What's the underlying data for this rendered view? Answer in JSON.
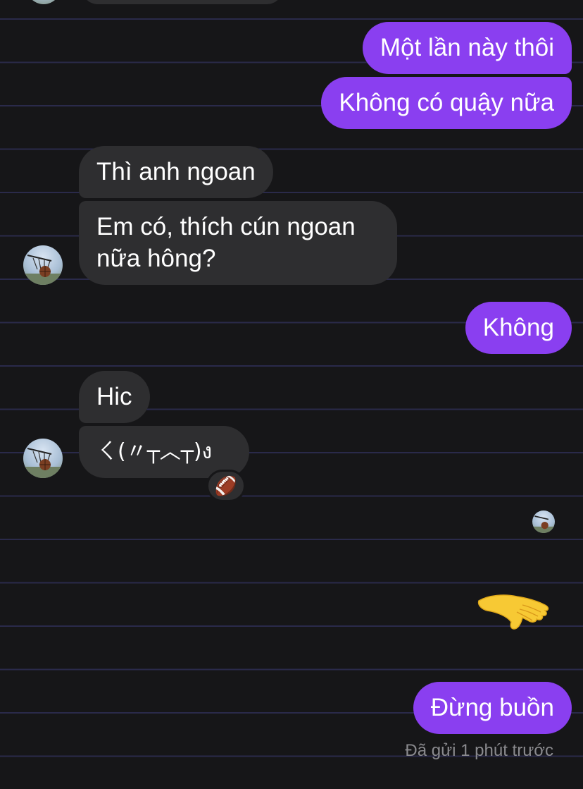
{
  "messages": {
    "m1": "Một lần này thôi",
    "m2": "Không có quậy nữa",
    "m3": "Thì anh ngoan",
    "m4_line1": "Em có, thích cún ngoan",
    "m4_line2": "nữa hông?",
    "m5": "Không",
    "m6": "Hic",
    "m7": "ㄑ(〃┬︿┬)ง",
    "m8": "Đừng buồn"
  },
  "reaction": "🏈",
  "status": "Đã gửi 1 phút trước",
  "icons": {
    "avatar": "basketball-hoop-avatar",
    "reaction": "football-emoji",
    "sticker": "hand-emoji"
  },
  "colors": {
    "background": "#161618",
    "outgoing_bubble": "#8a3ff0",
    "incoming_bubble": "#2e2e30",
    "status_text": "#8a8a8e"
  }
}
